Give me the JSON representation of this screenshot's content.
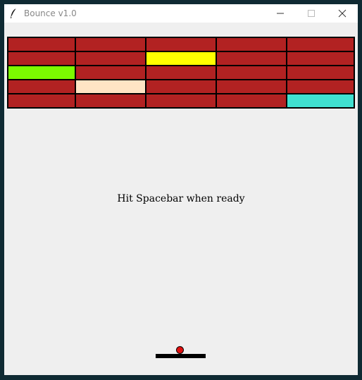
{
  "window": {
    "title": "Bounce v1.0",
    "icon": "feather-icon",
    "controls": [
      "minimize-icon",
      "maximize-icon",
      "close-icon"
    ]
  },
  "game": {
    "message": "Hit Spacebar when ready",
    "colors": {
      "background": "#efefef",
      "brick_default": "#b22222",
      "paddle": "#000000",
      "ball": "#e01010"
    },
    "bricks": {
      "rows": 5,
      "cols": 5,
      "colors": [
        [
          "#b22222",
          "#b22222",
          "#b22222",
          "#b22222",
          "#b22222"
        ],
        [
          "#b22222",
          "#b22222",
          "#ffff00",
          "#b22222",
          "#b22222"
        ],
        [
          "#7cfc00",
          "#b22222",
          "#b22222",
          "#b22222",
          "#b22222"
        ],
        [
          "#b22222",
          "#ffe4c4",
          "#b22222",
          "#b22222",
          "#b22222"
        ],
        [
          "#b22222",
          "#b22222",
          "#b22222",
          "#b22222",
          "#40e0d0"
        ]
      ]
    }
  }
}
